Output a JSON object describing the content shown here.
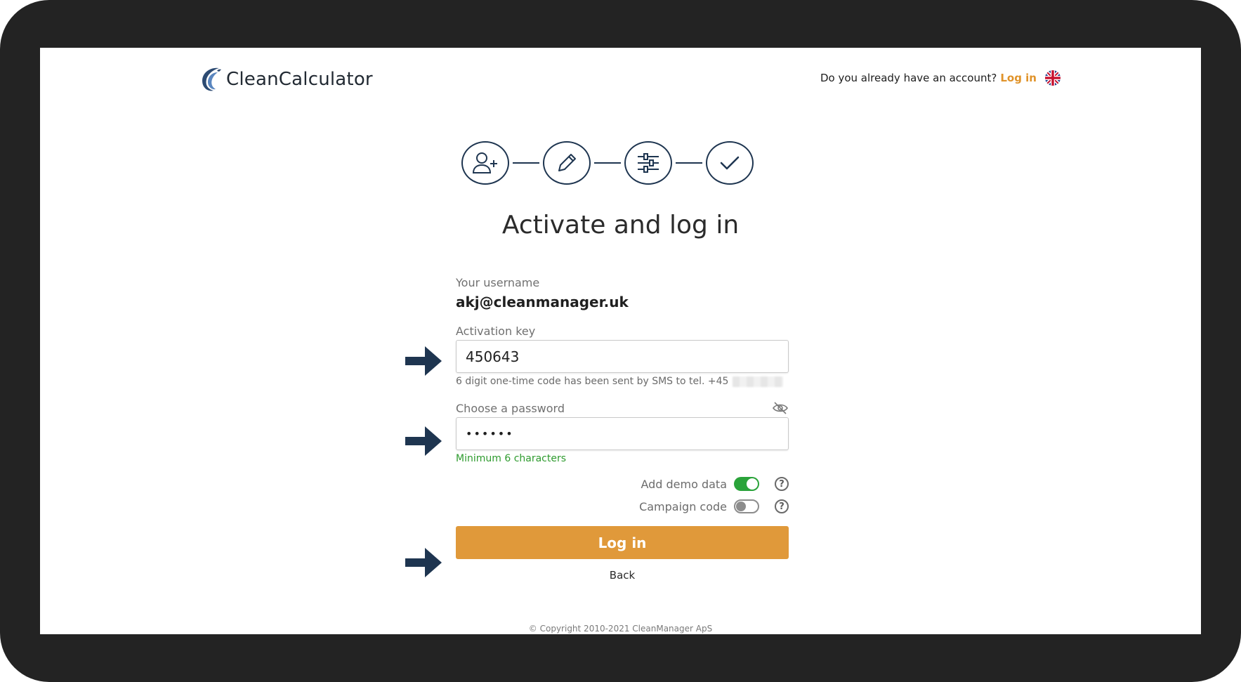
{
  "header": {
    "brand": "CleanCalculator",
    "account_prompt": "Do you already have an account?",
    "login_link": "Log in",
    "language_icon": "uk-flag-icon"
  },
  "steps": [
    {
      "icon": "add-user-icon"
    },
    {
      "icon": "pencil-icon"
    },
    {
      "icon": "sliders-icon"
    },
    {
      "icon": "checkmark-icon"
    }
  ],
  "title": "Activate and log in",
  "form": {
    "username_label": "Your username",
    "username_value": "akj@cleanmanager.uk",
    "activation_label": "Activation key",
    "activation_value": "450643",
    "activation_hint": "6 digit one-time code has been sent by SMS to tel. +45",
    "password_label": "Choose a password",
    "password_value": "••••••",
    "password_hint": "Minimum 6 characters",
    "demo_label": "Add demo data",
    "demo_on": true,
    "campaign_label": "Campaign code",
    "campaign_on": false,
    "help_symbol": "?",
    "login_button": "Log in",
    "back_link": "Back"
  },
  "footer": {
    "copyright": "© Copyright 2010-2021 CleanManager ApS"
  },
  "colors": {
    "accent": "#e0993a",
    "navy": "#1e3550",
    "toggle_on": "#2aa33a"
  }
}
